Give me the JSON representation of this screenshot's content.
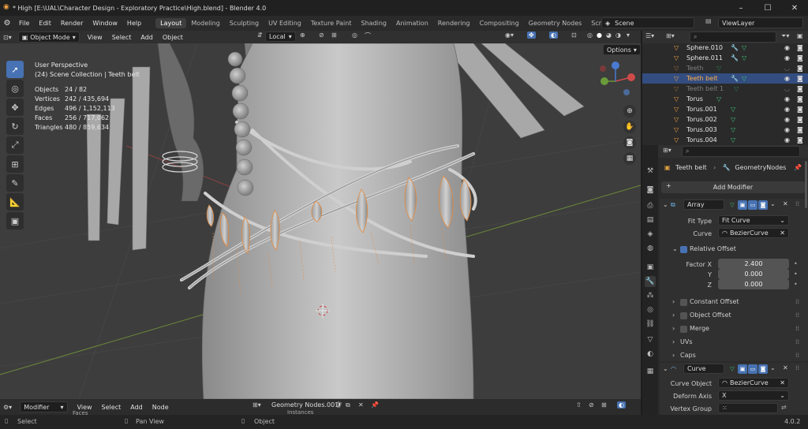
{
  "titlebar": {
    "title": "* High [E:\\UAL\\Character Design - Exploratory Practice\\High.blend] - Blender 4.0",
    "min": "–",
    "max": "☐",
    "close": "✕"
  },
  "menus": [
    "File",
    "Edit",
    "Render",
    "Window",
    "Help"
  ],
  "workspaces": [
    "Layout",
    "Modeling",
    "Sculpting",
    "UV Editing",
    "Texture Paint",
    "Shading",
    "Animation",
    "Rendering",
    "Compositing",
    "Geometry Nodes",
    "Scripting"
  ],
  "scene": "Scene",
  "view_layer": "ViewLayer",
  "viewport_header": {
    "mode": "Object Mode",
    "menus": [
      "View",
      "Select",
      "Add",
      "Object"
    ],
    "transform_space": "Local",
    "options": "Options"
  },
  "overlay_stats": {
    "view": "User Perspective",
    "collection": "(24) Scene Collection | Teeth belt",
    "rows": [
      {
        "label": "Objects",
        "value": "24 / 82"
      },
      {
        "label": "Vertices",
        "value": "242 / 435,694"
      },
      {
        "label": "Edges",
        "value": "496 / 1,152,113"
      },
      {
        "label": "Faces",
        "value": "256 / 717,062"
      },
      {
        "label": "Triangles",
        "value": "480 / 859,634"
      }
    ]
  },
  "outliner": [
    {
      "name": "Sphere.010",
      "state": "normal"
    },
    {
      "name": "Sphere.011",
      "state": "normal"
    },
    {
      "name": "Teeth",
      "state": "dim"
    },
    {
      "name": "Teeth belt",
      "state": "selected"
    },
    {
      "name": "Teeth belt 1",
      "state": "dim"
    },
    {
      "name": "Torus",
      "state": "normal"
    },
    {
      "name": "Torus.001",
      "state": "normal"
    },
    {
      "name": "Torus.002",
      "state": "normal"
    },
    {
      "name": "Torus.003",
      "state": "normal"
    },
    {
      "name": "Torus.004",
      "state": "normal"
    }
  ],
  "properties": {
    "breadcrumb_object": "Teeth belt",
    "breadcrumb_modifier": "GeometryNodes",
    "add_modifier": "Add Modifier",
    "array": {
      "name": "Array",
      "fit_type_label": "Fit Type",
      "fit_type_value": "Fit Curve",
      "curve_label": "Curve",
      "curve_value": "BezierCurve",
      "relative_offset": "Relative Offset",
      "factor_x_label": "Factor X",
      "factor_x": "2.400",
      "y_label": "Y",
      "y": "0.000",
      "z_label": "Z",
      "z": "0.000",
      "constant_offset": "Constant Offset",
      "object_offset": "Object Offset",
      "merge": "Merge",
      "uvs": "UVs",
      "caps": "Caps"
    },
    "curve_mod": {
      "name": "Curve",
      "curve_object_label": "Curve Object",
      "curve_object_value": "BezierCurve",
      "deform_axis_label": "Deform Axis",
      "deform_axis_value": "X",
      "vertex_group_label": "Vertex Group"
    }
  },
  "bottom_editor": {
    "mode": "Modifier",
    "menus": [
      "View",
      "Select",
      "Add",
      "Node"
    ],
    "node_group": "Geometry Nodes.001",
    "node_faces": "Faces",
    "node_instances": "Instances"
  },
  "statusbar": {
    "select": "Select",
    "pan": "Pan View",
    "object": "Object",
    "version": "4.0.2"
  }
}
